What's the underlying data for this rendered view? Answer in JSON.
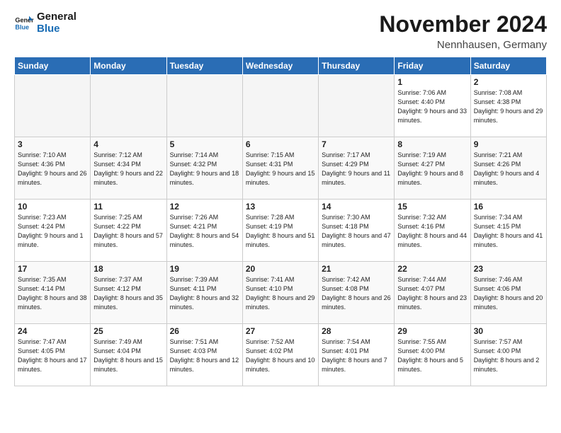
{
  "header": {
    "logo_line1": "General",
    "logo_line2": "Blue",
    "month": "November 2024",
    "location": "Nennhausen, Germany"
  },
  "weekdays": [
    "Sunday",
    "Monday",
    "Tuesday",
    "Wednesday",
    "Thursday",
    "Friday",
    "Saturday"
  ],
  "weeks": [
    [
      {
        "day": "",
        "empty": true
      },
      {
        "day": "",
        "empty": true
      },
      {
        "day": "",
        "empty": true
      },
      {
        "day": "",
        "empty": true
      },
      {
        "day": "",
        "empty": true
      },
      {
        "day": "1",
        "sunrise": "Sunrise: 7:06 AM",
        "sunset": "Sunset: 4:40 PM",
        "daylight": "Daylight: 9 hours and 33 minutes."
      },
      {
        "day": "2",
        "sunrise": "Sunrise: 7:08 AM",
        "sunset": "Sunset: 4:38 PM",
        "daylight": "Daylight: 9 hours and 29 minutes."
      }
    ],
    [
      {
        "day": "3",
        "sunrise": "Sunrise: 7:10 AM",
        "sunset": "Sunset: 4:36 PM",
        "daylight": "Daylight: 9 hours and 26 minutes."
      },
      {
        "day": "4",
        "sunrise": "Sunrise: 7:12 AM",
        "sunset": "Sunset: 4:34 PM",
        "daylight": "Daylight: 9 hours and 22 minutes."
      },
      {
        "day": "5",
        "sunrise": "Sunrise: 7:14 AM",
        "sunset": "Sunset: 4:32 PM",
        "daylight": "Daylight: 9 hours and 18 minutes."
      },
      {
        "day": "6",
        "sunrise": "Sunrise: 7:15 AM",
        "sunset": "Sunset: 4:31 PM",
        "daylight": "Daylight: 9 hours and 15 minutes."
      },
      {
        "day": "7",
        "sunrise": "Sunrise: 7:17 AM",
        "sunset": "Sunset: 4:29 PM",
        "daylight": "Daylight: 9 hours and 11 minutes."
      },
      {
        "day": "8",
        "sunrise": "Sunrise: 7:19 AM",
        "sunset": "Sunset: 4:27 PM",
        "daylight": "Daylight: 9 hours and 8 minutes."
      },
      {
        "day": "9",
        "sunrise": "Sunrise: 7:21 AM",
        "sunset": "Sunset: 4:26 PM",
        "daylight": "Daylight: 9 hours and 4 minutes."
      }
    ],
    [
      {
        "day": "10",
        "sunrise": "Sunrise: 7:23 AM",
        "sunset": "Sunset: 4:24 PM",
        "daylight": "Daylight: 9 hours and 1 minute."
      },
      {
        "day": "11",
        "sunrise": "Sunrise: 7:25 AM",
        "sunset": "Sunset: 4:22 PM",
        "daylight": "Daylight: 8 hours and 57 minutes."
      },
      {
        "day": "12",
        "sunrise": "Sunrise: 7:26 AM",
        "sunset": "Sunset: 4:21 PM",
        "daylight": "Daylight: 8 hours and 54 minutes."
      },
      {
        "day": "13",
        "sunrise": "Sunrise: 7:28 AM",
        "sunset": "Sunset: 4:19 PM",
        "daylight": "Daylight: 8 hours and 51 minutes."
      },
      {
        "day": "14",
        "sunrise": "Sunrise: 7:30 AM",
        "sunset": "Sunset: 4:18 PM",
        "daylight": "Daylight: 8 hours and 47 minutes."
      },
      {
        "day": "15",
        "sunrise": "Sunrise: 7:32 AM",
        "sunset": "Sunset: 4:16 PM",
        "daylight": "Daylight: 8 hours and 44 minutes."
      },
      {
        "day": "16",
        "sunrise": "Sunrise: 7:34 AM",
        "sunset": "Sunset: 4:15 PM",
        "daylight": "Daylight: 8 hours and 41 minutes."
      }
    ],
    [
      {
        "day": "17",
        "sunrise": "Sunrise: 7:35 AM",
        "sunset": "Sunset: 4:14 PM",
        "daylight": "Daylight: 8 hours and 38 minutes."
      },
      {
        "day": "18",
        "sunrise": "Sunrise: 7:37 AM",
        "sunset": "Sunset: 4:12 PM",
        "daylight": "Daylight: 8 hours and 35 minutes."
      },
      {
        "day": "19",
        "sunrise": "Sunrise: 7:39 AM",
        "sunset": "Sunset: 4:11 PM",
        "daylight": "Daylight: 8 hours and 32 minutes."
      },
      {
        "day": "20",
        "sunrise": "Sunrise: 7:41 AM",
        "sunset": "Sunset: 4:10 PM",
        "daylight": "Daylight: 8 hours and 29 minutes."
      },
      {
        "day": "21",
        "sunrise": "Sunrise: 7:42 AM",
        "sunset": "Sunset: 4:08 PM",
        "daylight": "Daylight: 8 hours and 26 minutes."
      },
      {
        "day": "22",
        "sunrise": "Sunrise: 7:44 AM",
        "sunset": "Sunset: 4:07 PM",
        "daylight": "Daylight: 8 hours and 23 minutes."
      },
      {
        "day": "23",
        "sunrise": "Sunrise: 7:46 AM",
        "sunset": "Sunset: 4:06 PM",
        "daylight": "Daylight: 8 hours and 20 minutes."
      }
    ],
    [
      {
        "day": "24",
        "sunrise": "Sunrise: 7:47 AM",
        "sunset": "Sunset: 4:05 PM",
        "daylight": "Daylight: 8 hours and 17 minutes."
      },
      {
        "day": "25",
        "sunrise": "Sunrise: 7:49 AM",
        "sunset": "Sunset: 4:04 PM",
        "daylight": "Daylight: 8 hours and 15 minutes."
      },
      {
        "day": "26",
        "sunrise": "Sunrise: 7:51 AM",
        "sunset": "Sunset: 4:03 PM",
        "daylight": "Daylight: 8 hours and 12 minutes."
      },
      {
        "day": "27",
        "sunrise": "Sunrise: 7:52 AM",
        "sunset": "Sunset: 4:02 PM",
        "daylight": "Daylight: 8 hours and 10 minutes."
      },
      {
        "day": "28",
        "sunrise": "Sunrise: 7:54 AM",
        "sunset": "Sunset: 4:01 PM",
        "daylight": "Daylight: 8 hours and 7 minutes."
      },
      {
        "day": "29",
        "sunrise": "Sunrise: 7:55 AM",
        "sunset": "Sunset: 4:00 PM",
        "daylight": "Daylight: 8 hours and 5 minutes."
      },
      {
        "day": "30",
        "sunrise": "Sunrise: 7:57 AM",
        "sunset": "Sunset: 4:00 PM",
        "daylight": "Daylight: 8 hours and 2 minutes."
      }
    ]
  ]
}
